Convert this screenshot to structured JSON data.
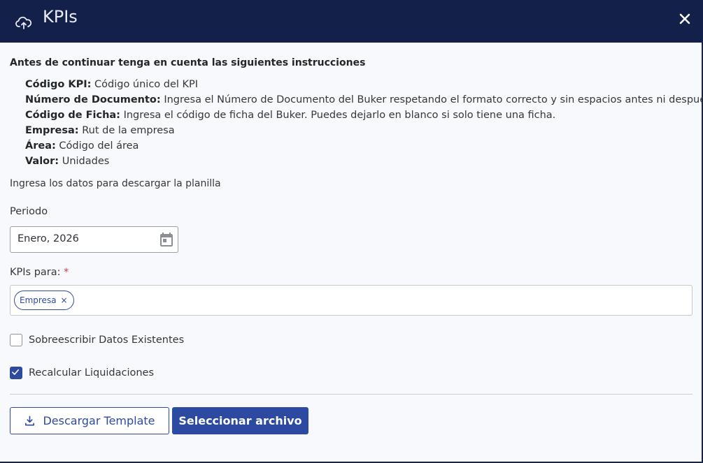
{
  "header": {
    "title": "KPIs",
    "icon": "cloud-upload-icon",
    "close_icon": "close-icon",
    "background": "#13204a"
  },
  "intro": "Antes de continuar tenga en cuenta las siguientes instrucciones",
  "instructions": [
    {
      "term": "Código KPI:",
      "desc": "Código único del KPI"
    },
    {
      "term": "Número de Documento:",
      "desc": "Ingresa el Número de Documento del Buker respetando el formato correcto y sin espacios antes ni después."
    },
    {
      "term": "Código de Ficha:",
      "desc": "Ingresa el código de ficha del Buker. Puedes dejarlo en blanco si solo tiene una ficha."
    },
    {
      "term": "Empresa:",
      "desc": "Rut de la empresa"
    },
    {
      "term": "Área:",
      "desc": "Código del área"
    },
    {
      "term": "Valor:",
      "desc": "Unidades"
    }
  ],
  "subtitle": "Ingresa los datos para descargar la planilla",
  "periodo": {
    "label": "Periodo",
    "value": "Enero, 2026",
    "icon": "calendar-icon"
  },
  "kpis_para": {
    "label": "KPIs para:",
    "required_mark": "*",
    "chips": [
      {
        "label": "Empresa",
        "remove": "×"
      }
    ]
  },
  "checkboxes": {
    "overwrite": {
      "label": "Sobreescribir Datos Existentes",
      "checked": false
    },
    "recalc": {
      "label": "Recalcular Liquidaciones",
      "checked": true
    }
  },
  "buttons": {
    "download_label": "Descargar Template",
    "select_label": "Seleccionar archivo"
  },
  "colors": {
    "accent": "#2d4aa3",
    "required": "#d23b3b"
  }
}
